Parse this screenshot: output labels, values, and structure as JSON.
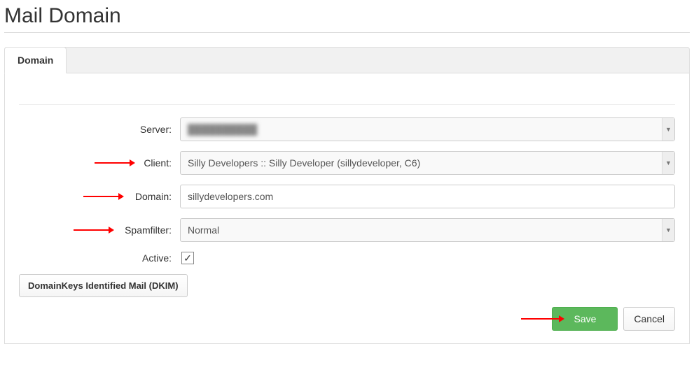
{
  "page": {
    "title": "Mail Domain"
  },
  "tabs": [
    {
      "label": "Domain"
    }
  ],
  "form": {
    "server": {
      "label": "Server:",
      "value": "██████████"
    },
    "client": {
      "label": "Client:",
      "value": "Silly Developers :: Silly Developer (sillydeveloper, C6)"
    },
    "domain": {
      "label": "Domain:",
      "value": "sillydevelopers.com"
    },
    "spamfilter": {
      "label": "Spamfilter:",
      "value": "Normal"
    },
    "active": {
      "label": "Active:",
      "checked": true
    }
  },
  "buttons": {
    "dkim": "DomainKeys Identified Mail (DKIM)",
    "save": "Save",
    "cancel": "Cancel"
  }
}
